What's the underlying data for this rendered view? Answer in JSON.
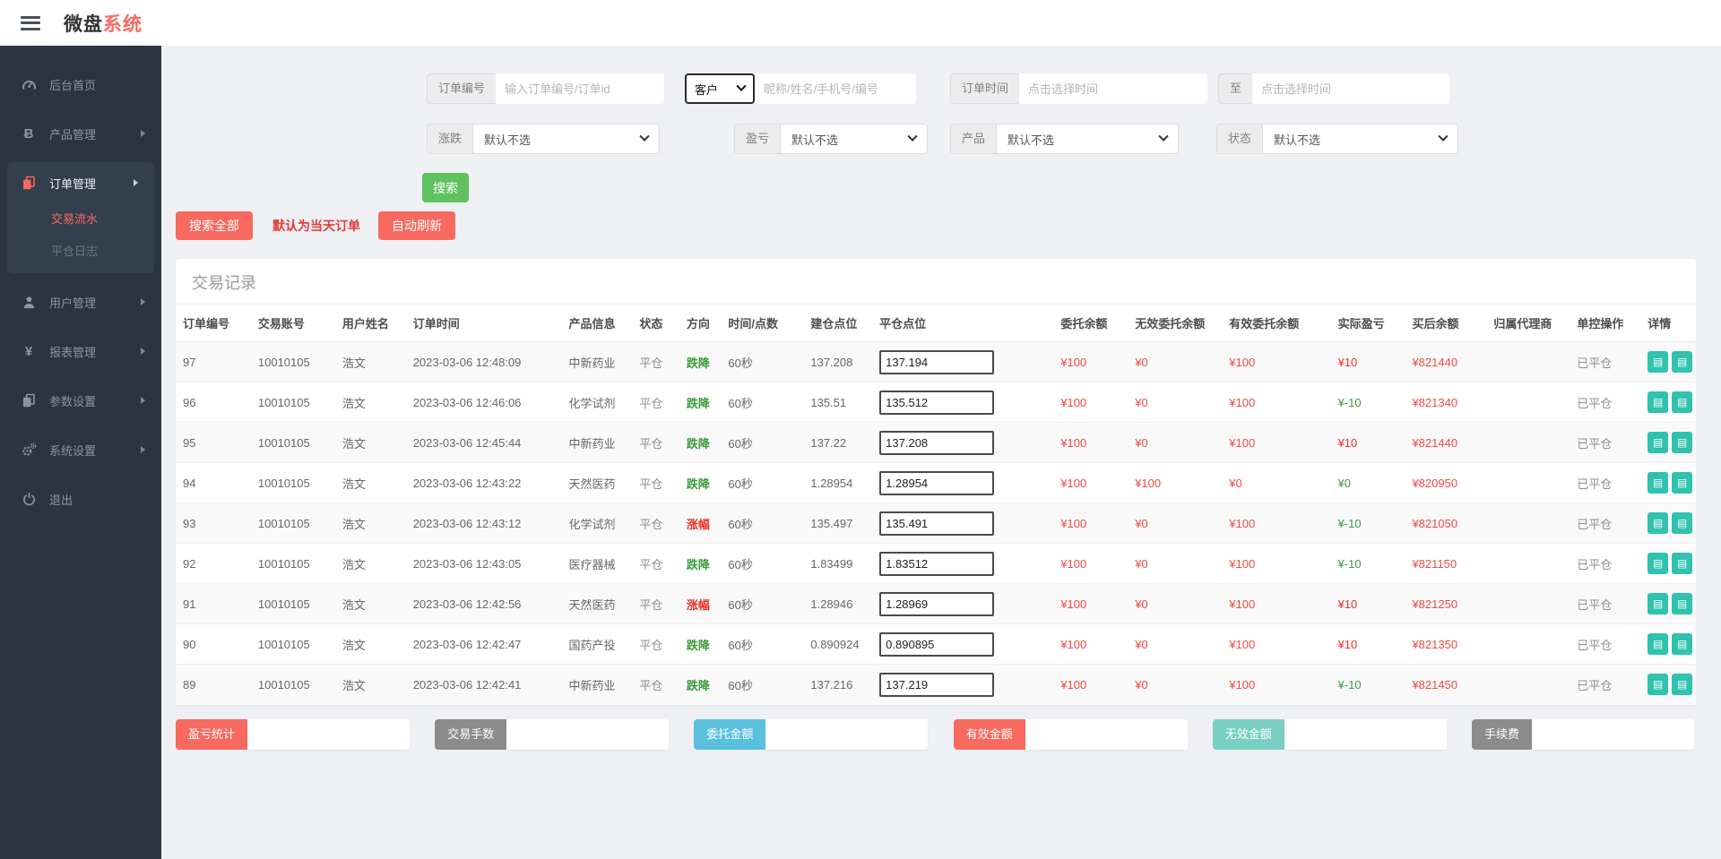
{
  "brand": {
    "black": "微盘",
    "red": "系统"
  },
  "sidebar": {
    "items": [
      {
        "id": "dashboard",
        "icon": "dashboard-icon",
        "label": "后台首页",
        "arrow": false,
        "active": false
      },
      {
        "id": "products",
        "icon": "bitcoin-icon",
        "label": "产品管理",
        "arrow": true,
        "active": false
      },
      {
        "id": "orders",
        "icon": "orders-icon",
        "label": "订单管理",
        "arrow": true,
        "active": true,
        "children": [
          {
            "label": "交易流水",
            "active": true
          },
          {
            "label": "平仓日志",
            "active": false
          }
        ]
      },
      {
        "id": "users",
        "icon": "user-icon",
        "label": "用户管理",
        "arrow": true,
        "active": false
      },
      {
        "id": "reports",
        "icon": "yen-icon",
        "label": "报表管理",
        "arrow": true,
        "active": false
      },
      {
        "id": "params",
        "icon": "params-icon",
        "label": "参数设置",
        "arrow": true,
        "active": false
      },
      {
        "id": "system",
        "icon": "gears-icon",
        "label": "系统设置",
        "arrow": true,
        "active": false
      },
      {
        "id": "logout",
        "icon": "power-icon",
        "label": "退出",
        "arrow": false,
        "active": false
      }
    ]
  },
  "filters": {
    "order_no": {
      "label": "订单编号",
      "placeholder": "输入订单编号/订单id"
    },
    "customer": {
      "select_value": "客户",
      "placeholder": "昵称/姓名/手机号/编号"
    },
    "order_time": {
      "label": "订单时间",
      "placeholder": "点击选择时间"
    },
    "to": {
      "label": "至",
      "placeholder": "点击选择时间"
    },
    "rise_fall": {
      "label": "涨跌",
      "value": "默认不选"
    },
    "profit_loss": {
      "label": "盈亏",
      "value": "默认不选"
    },
    "product": {
      "label": "产品",
      "value": "默认不选"
    },
    "status": {
      "label": "状态",
      "value": "默认不选"
    },
    "search_button": "搜索"
  },
  "actions": {
    "search_all": "搜索全部",
    "today_note": "默认为当天订单",
    "auto_refresh": "自动刷新"
  },
  "table": {
    "title": "交易记录",
    "columns": [
      "订单编号",
      "交易账号",
      "用户姓名",
      "订单时间",
      "产品信息",
      "状态",
      "方向",
      "时间/点数",
      "建仓点位",
      "平仓点位",
      "委托余额",
      "无效委托余额",
      "有效委托余额",
      "实际盈亏",
      "买后余额",
      "归属代理商",
      "单控操作",
      "详情"
    ],
    "detail_icon": "order-detail-icon",
    "rows": [
      {
        "order_no": "97",
        "account": "10010105",
        "name": "浩文",
        "time": "2023-03-06 12:48:09",
        "product": "中新药业",
        "status": "平仓",
        "direction": "跌降",
        "direction_type": "down",
        "duration": "60秒",
        "open_point": "137.208",
        "close_point": "137.194",
        "entrust": "¥100",
        "invalid_entrust": "¥0",
        "valid_entrust": "¥100",
        "profit": "¥10",
        "profit_type": "up",
        "after_balance": "¥821440",
        "agent": "",
        "control": "已平仓"
      },
      {
        "order_no": "96",
        "account": "10010105",
        "name": "浩文",
        "time": "2023-03-06 12:46:06",
        "product": "化学试剂",
        "status": "平仓",
        "direction": "跌降",
        "direction_type": "down",
        "duration": "60秒",
        "open_point": "135.51",
        "close_point": "135.512",
        "entrust": "¥100",
        "invalid_entrust": "¥0",
        "valid_entrust": "¥100",
        "profit": "¥-10",
        "profit_type": "down",
        "after_balance": "¥821340",
        "agent": "",
        "control": "已平仓"
      },
      {
        "order_no": "95",
        "account": "10010105",
        "name": "浩文",
        "time": "2023-03-06 12:45:44",
        "product": "中新药业",
        "status": "平仓",
        "direction": "跌降",
        "direction_type": "down",
        "duration": "60秒",
        "open_point": "137.22",
        "close_point": "137.208",
        "entrust": "¥100",
        "invalid_entrust": "¥0",
        "valid_entrust": "¥100",
        "profit": "¥10",
        "profit_type": "up",
        "after_balance": "¥821440",
        "agent": "",
        "control": "已平仓"
      },
      {
        "order_no": "94",
        "account": "10010105",
        "name": "浩文",
        "time": "2023-03-06 12:43:22",
        "product": "天然医药",
        "status": "平仓",
        "direction": "跌降",
        "direction_type": "down",
        "duration": "60秒",
        "open_point": "1.28954",
        "close_point": "1.28954",
        "entrust": "¥100",
        "invalid_entrust": "¥100",
        "valid_entrust": "¥0",
        "profit": "¥0",
        "profit_type": "down",
        "after_balance": "¥820950",
        "agent": "",
        "control": "已平仓"
      },
      {
        "order_no": "93",
        "account": "10010105",
        "name": "浩文",
        "time": "2023-03-06 12:43:12",
        "product": "化学试剂",
        "status": "平仓",
        "direction": "涨幅",
        "direction_type": "up",
        "duration": "60秒",
        "open_point": "135.497",
        "close_point": "135.491",
        "entrust": "¥100",
        "invalid_entrust": "¥0",
        "valid_entrust": "¥100",
        "profit": "¥-10",
        "profit_type": "down",
        "after_balance": "¥821050",
        "agent": "",
        "control": "已平仓"
      },
      {
        "order_no": "92",
        "account": "10010105",
        "name": "浩文",
        "time": "2023-03-06 12:43:05",
        "product": "医疗器械",
        "status": "平仓",
        "direction": "跌降",
        "direction_type": "down",
        "duration": "60秒",
        "open_point": "1.83499",
        "close_point": "1.83512",
        "entrust": "¥100",
        "invalid_entrust": "¥0",
        "valid_entrust": "¥100",
        "profit": "¥-10",
        "profit_type": "down",
        "after_balance": "¥821150",
        "agent": "",
        "control": "已平仓"
      },
      {
        "order_no": "91",
        "account": "10010105",
        "name": "浩文",
        "time": "2023-03-06 12:42:56",
        "product": "天然医药",
        "status": "平仓",
        "direction": "涨幅",
        "direction_type": "up",
        "duration": "60秒",
        "open_point": "1.28946",
        "close_point": "1.28969",
        "entrust": "¥100",
        "invalid_entrust": "¥0",
        "valid_entrust": "¥100",
        "profit": "¥10",
        "profit_type": "up",
        "after_balance": "¥821250",
        "agent": "",
        "control": "已平仓"
      },
      {
        "order_no": "90",
        "account": "10010105",
        "name": "浩文",
        "time": "2023-03-06 12:42:47",
        "product": "国药产投",
        "status": "平仓",
        "direction": "跌降",
        "direction_type": "down",
        "duration": "60秒",
        "open_point": "0.890924",
        "close_point": "0.890895",
        "entrust": "¥100",
        "invalid_entrust": "¥0",
        "valid_entrust": "¥100",
        "profit": "¥10",
        "profit_type": "up",
        "after_balance": "¥821350",
        "agent": "",
        "control": "已平仓"
      },
      {
        "order_no": "89",
        "account": "10010105",
        "name": "浩文",
        "time": "2023-03-06 12:42:41",
        "product": "中新药业",
        "status": "平仓",
        "direction": "跌降",
        "direction_type": "down",
        "duration": "60秒",
        "open_point": "137.216",
        "close_point": "137.219",
        "entrust": "¥100",
        "invalid_entrust": "¥0",
        "valid_entrust": "¥100",
        "profit": "¥-10",
        "profit_type": "down",
        "after_balance": "¥821450",
        "agent": "",
        "control": "已平仓"
      }
    ]
  },
  "summary": [
    {
      "label": "盈亏统计",
      "color": "#f8695f",
      "value": ""
    },
    {
      "label": "交易手数",
      "color": "#8c8c8c",
      "value": ""
    },
    {
      "label": "委托金额",
      "color": "#5bc0de",
      "value": ""
    },
    {
      "label": "有效金额",
      "color": "#f8695f",
      "value": ""
    },
    {
      "label": "无效金额",
      "color": "#79cfc1",
      "value": ""
    },
    {
      "label": "手续费",
      "color": "#8c8c8c",
      "value": ""
    }
  ],
  "colors": {
    "accent_red": "#f8695f",
    "money_red": "#f2483e",
    "up_red": "#ee2f26",
    "down_green": "#3b9c3b",
    "green_button": "#5fc25f",
    "teal_button": "#2fc2ae",
    "sidebar_bg": "#2b3542",
    "page_bg": "#eef0f4"
  }
}
